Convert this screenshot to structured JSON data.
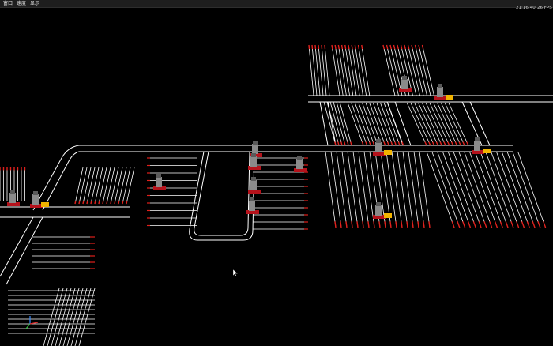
{
  "menubar": {
    "items": [
      {
        "label": "窗口"
      },
      {
        "label": "速度"
      },
      {
        "label": "显示"
      }
    ]
  },
  "status": {
    "time": "21:16:40",
    "fps": "26 FPS"
  },
  "scene": {
    "colors": {
      "background": "#000000",
      "path": "#ffffff",
      "path_tip": "#e0201c",
      "robot_body": "#8a8a8a",
      "robot_base": "#b5121b",
      "rack": "#f2b400"
    }
  }
}
